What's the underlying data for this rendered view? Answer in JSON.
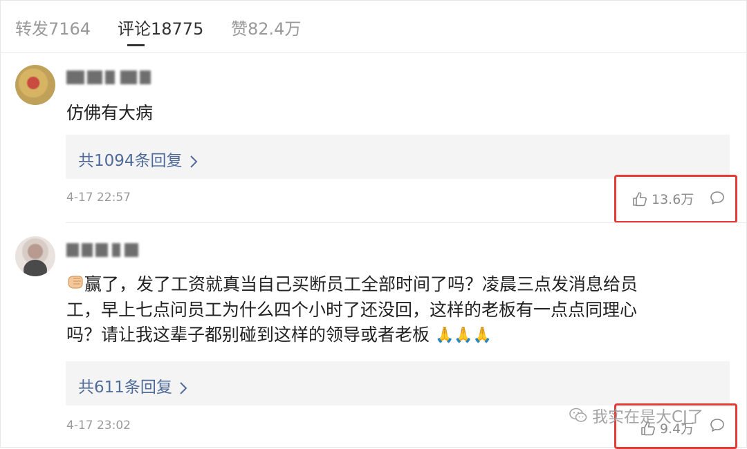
{
  "tabs": [
    {
      "label": "转发7164"
    },
    {
      "label": "评论18775"
    },
    {
      "label": "赞82.4万"
    }
  ],
  "comments": [
    {
      "text": "仿佛有大病",
      "reply_link": "共1094条回复",
      "time": "4-17 22:57",
      "likes": "13.6万"
    },
    {
      "text_line1": "赢了，发了工资就真当自己买断员工全部时间了吗？凌晨三点发消息给员",
      "text_line2": "工，早上七点问员工为什么四个小时了还没回，这样的老板有一点点同理心",
      "text_line3": "吗？请让我这辈子都别碰到这样的领导或者老板",
      "emoji_prefix": "fist-emoji",
      "emoji_suffix": "🙏🙏🙏",
      "reply_link": "共611条回复",
      "time": "4-17 23:02",
      "likes": "9.4万"
    }
  ],
  "watermark": {
    "label": "我实在是大CJ了"
  },
  "icons": {
    "like": "thumbs-up-icon",
    "reply": "speech-bubble-icon",
    "chevron": "chevron-right-icon",
    "watermark": "wechat-icon"
  },
  "colors": {
    "link": "#4f6b9a",
    "highlight": "#e53935"
  }
}
